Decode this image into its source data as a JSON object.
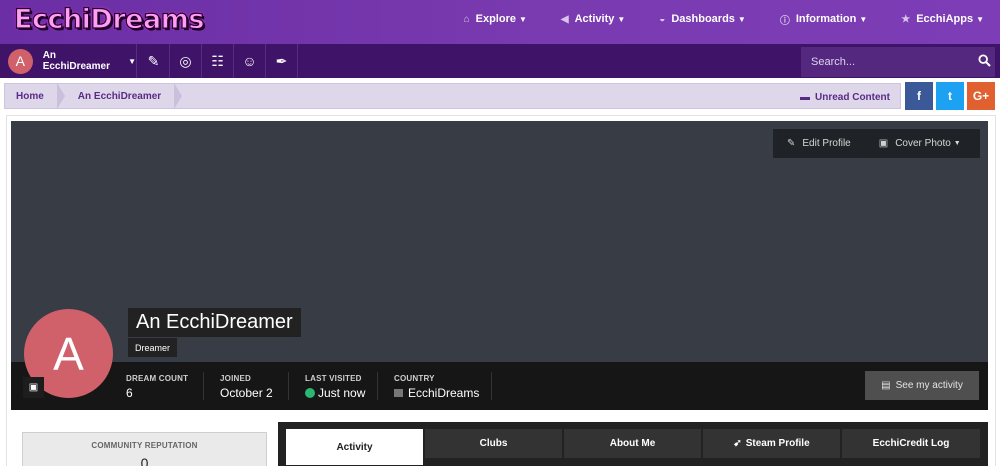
{
  "site": {
    "logo": "EcchiDreams"
  },
  "nav": [
    {
      "label": "Explore",
      "icon": "home-icon",
      "glyph": "⌂"
    },
    {
      "label": "Activity",
      "icon": "megaphone-icon",
      "glyph": "◀"
    },
    {
      "label": "Dashboards",
      "icon": "dashboard-icon",
      "glyph": "◒"
    },
    {
      "label": "Information",
      "icon": "info-icon",
      "glyph": "ⓘ"
    },
    {
      "label": "EcchiApps",
      "icon": "star-icon",
      "glyph": "★"
    }
  ],
  "userbar": {
    "avatar_letter": "A",
    "user_name": "An EcchiDreamer",
    "quick_icons": [
      {
        "name": "pencil-icon",
        "glyph": "✎"
      },
      {
        "name": "globe-icon",
        "glyph": "◎"
      },
      {
        "name": "chat-bubbles-icon",
        "glyph": "☷"
      },
      {
        "name": "smiley-icon",
        "glyph": "☺"
      },
      {
        "name": "paintbrush-icon",
        "glyph": "✒"
      }
    ]
  },
  "search": {
    "placeholder": "Search..."
  },
  "breadcrumb": {
    "items": [
      "Home",
      "An EcchiDreamer"
    ],
    "unread": "Unread Content"
  },
  "social": {
    "facebook": "f",
    "twitter": "t",
    "googleplus": "G+"
  },
  "profile": {
    "edit_profile": "Edit Profile",
    "cover_photo": "Cover Photo",
    "name": "An EcchiDreamer",
    "group": "Dreamer",
    "avatar_letter": "A",
    "stats": [
      {
        "label": "DREAM COUNT",
        "value": "6"
      },
      {
        "label": "JOINED",
        "value": "October 2"
      },
      {
        "label": "LAST VISITED",
        "value": "Just now"
      },
      {
        "label": "COUNTRY",
        "value": "EcchiDreams"
      }
    ],
    "see_activity": "See my activity",
    "reputation_label": "COMMUNITY REPUTATION",
    "reputation_value": "0"
  },
  "tabs": [
    "Activity",
    "Clubs",
    "About Me",
    "Steam Profile",
    "EcchiCredit Log"
  ],
  "colors": {
    "accent": "#6b2ea4",
    "facebook": "#3b5998",
    "twitter": "#1da1f2",
    "googleplus": "#e0612f",
    "online": "#2bb673"
  }
}
